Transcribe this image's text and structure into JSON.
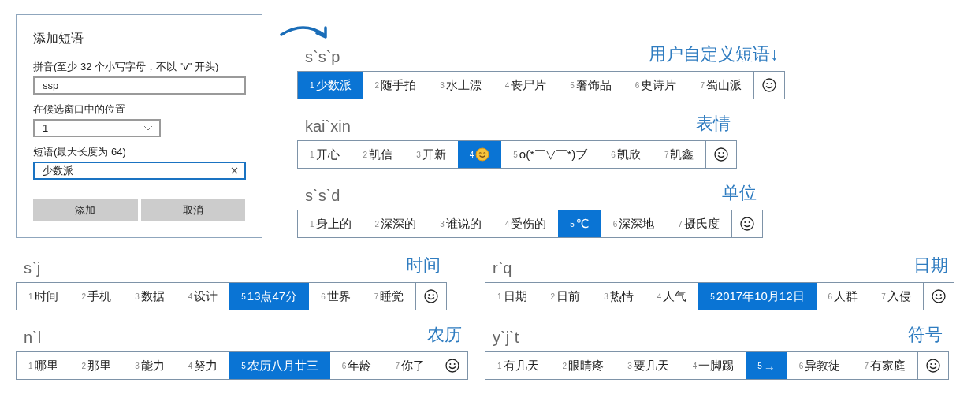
{
  "dialog": {
    "title": "添加短语",
    "fields": [
      {
        "kind": "text",
        "label": "拼音(至少 32 个小写字母，不以 \"v\" 开头)",
        "value": "ssp",
        "focused": false
      },
      {
        "kind": "select",
        "label": "在候选窗口中的位置",
        "value": "1",
        "focused": false
      },
      {
        "kind": "clearable",
        "label": "短语(最大长度为 64)",
        "value": "少数派",
        "focused": true
      }
    ],
    "buttons": [
      "添加",
      "取消"
    ]
  },
  "examples": [
    {
      "pinyin": "s`s`p",
      "category": "用户自定义短语↓",
      "candidates": [
        {
          "num": "1",
          "text": "少数派",
          "selected": true
        },
        {
          "num": "2",
          "text": "随手拍",
          "selected": false
        },
        {
          "num": "3",
          "text": "水上漂",
          "selected": false
        },
        {
          "num": "4",
          "text": "丧尸片",
          "selected": false
        },
        {
          "num": "5",
          "text": "奢饰品",
          "selected": false
        },
        {
          "num": "6",
          "text": "史诗片",
          "selected": false
        },
        {
          "num": "7",
          "text": "蜀山派",
          "selected": false
        }
      ]
    },
    {
      "pinyin": "kai`xin",
      "category": "表情",
      "candidates": [
        {
          "num": "1",
          "text": "开心",
          "selected": false
        },
        {
          "num": "2",
          "text": "凯信",
          "selected": false
        },
        {
          "num": "3",
          "text": "开新",
          "selected": false
        },
        {
          "num": "4",
          "kind": "emoji",
          "selected": true
        },
        {
          "num": "5",
          "text": "o(*￣▽￣*)ブ",
          "selected": false
        },
        {
          "num": "6",
          "text": "凯欣",
          "selected": false
        },
        {
          "num": "7",
          "text": "凯鑫",
          "selected": false
        }
      ]
    },
    {
      "pinyin": "s`s`d",
      "category": "单位",
      "candidates": [
        {
          "num": "1",
          "text": "身上的",
          "selected": false
        },
        {
          "num": "2",
          "text": "深深的",
          "selected": false
        },
        {
          "num": "3",
          "text": "谁说的",
          "selected": false
        },
        {
          "num": "4",
          "text": "受伤的",
          "selected": false
        },
        {
          "num": "5",
          "text": "℃",
          "selected": true
        },
        {
          "num": "6",
          "text": "深深地",
          "selected": false
        },
        {
          "num": "7",
          "text": "摄氏度",
          "selected": false
        }
      ]
    },
    {
      "pinyin": "s`j",
      "category": "时间",
      "candidates": [
        {
          "num": "1",
          "text": "时间",
          "selected": false
        },
        {
          "num": "2",
          "text": "手机",
          "selected": false
        },
        {
          "num": "3",
          "text": "数据",
          "selected": false
        },
        {
          "num": "4",
          "text": "设计",
          "selected": false
        },
        {
          "num": "5",
          "text": "13点47分",
          "selected": true
        },
        {
          "num": "6",
          "text": "世界",
          "selected": false
        },
        {
          "num": "7",
          "text": "睡觉",
          "selected": false
        }
      ]
    },
    {
      "pinyin": "r`q",
      "category": "日期",
      "candidates": [
        {
          "num": "1",
          "text": "日期",
          "selected": false
        },
        {
          "num": "2",
          "text": "日前",
          "selected": false
        },
        {
          "num": "3",
          "text": "热情",
          "selected": false
        },
        {
          "num": "4",
          "text": "人气",
          "selected": false
        },
        {
          "num": "5",
          "text": "2017年10月12日",
          "selected": true
        },
        {
          "num": "6",
          "text": "人群",
          "selected": false
        },
        {
          "num": "7",
          "text": "入侵",
          "selected": false
        }
      ]
    },
    {
      "pinyin": "n`l",
      "category": "农历",
      "candidates": [
        {
          "num": "1",
          "text": "哪里",
          "selected": false
        },
        {
          "num": "2",
          "text": "那里",
          "selected": false
        },
        {
          "num": "3",
          "text": "能力",
          "selected": false
        },
        {
          "num": "4",
          "text": "努力",
          "selected": false
        },
        {
          "num": "5",
          "text": "农历八月廿三",
          "selected": true
        },
        {
          "num": "6",
          "text": "年龄",
          "selected": false
        },
        {
          "num": "7",
          "text": "你了",
          "selected": false
        }
      ]
    },
    {
      "pinyin": "y`j`t",
      "category": "符号",
      "candidates": [
        {
          "num": "1",
          "text": "有几天",
          "selected": false
        },
        {
          "num": "2",
          "text": "眼睛疼",
          "selected": false
        },
        {
          "num": "3",
          "text": "要几天",
          "selected": false
        },
        {
          "num": "4",
          "text": "一脚踢",
          "selected": false
        },
        {
          "num": "5",
          "text": "→",
          "selected": true
        },
        {
          "num": "6",
          "text": "异教徒",
          "selected": false
        },
        {
          "num": "7",
          "text": "有家庭",
          "selected": false
        }
      ]
    }
  ]
}
